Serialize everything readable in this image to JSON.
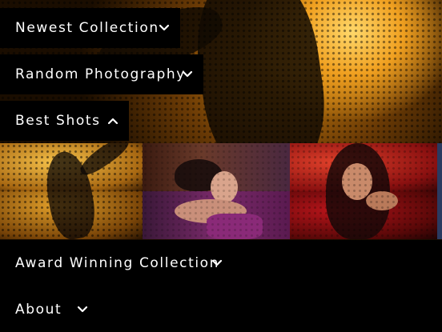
{
  "menu": {
    "items": [
      {
        "label": "Newest Collection",
        "icon": "chevron-down-icon"
      },
      {
        "label": "Random Photography",
        "icon": "chevron-down-icon"
      },
      {
        "label": "Best Shots",
        "icon": "chevron-up-icon"
      },
      {
        "label": "Award Winning Collection",
        "icon": "chevron-down-icon"
      },
      {
        "label": "About",
        "icon": "chevron-down-icon"
      }
    ]
  },
  "colors": {
    "bar_background": "#000000",
    "text": "#ffffff",
    "accent_gold": "#f0a020",
    "accent_purple": "#7a2a6a",
    "accent_red": "#b8141a"
  }
}
